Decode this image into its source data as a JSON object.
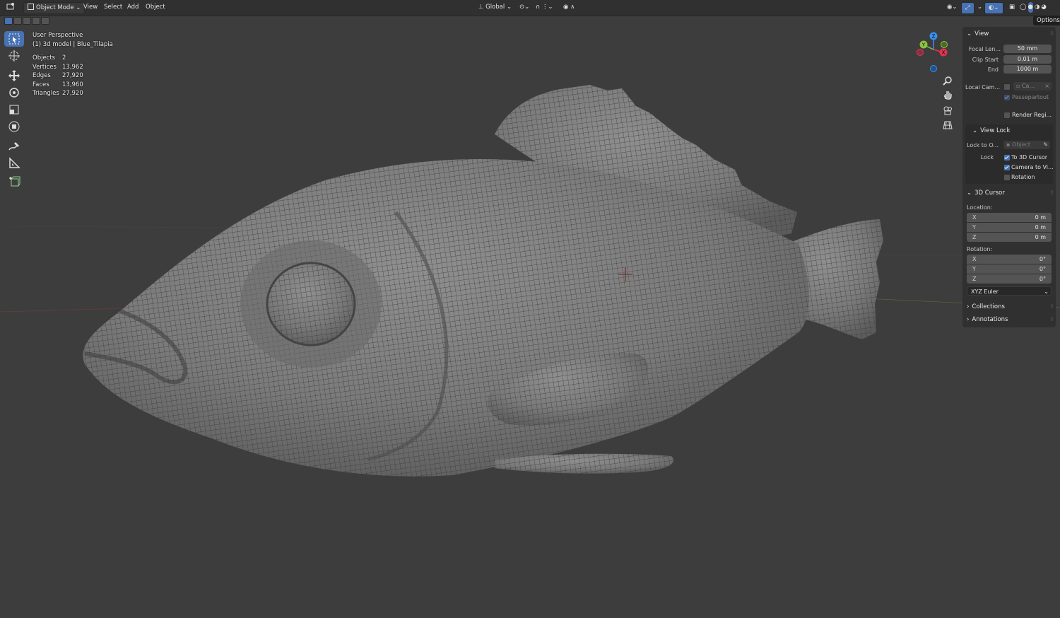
{
  "header": {
    "mode_label": "Object Mode",
    "menus": [
      "View",
      "Select",
      "Add",
      "Object"
    ],
    "orientation_label": "Global",
    "options_label": "Options"
  },
  "overlay": {
    "perspective": "User Perspective",
    "object_info": "(1) 3d model | Blue_Tilapia",
    "stats": [
      {
        "label": "Objects",
        "value": "2"
      },
      {
        "label": "Vertices",
        "value": "13,962"
      },
      {
        "label": "Edges",
        "value": "27,920"
      },
      {
        "label": "Faces",
        "value": "13,960"
      },
      {
        "label": "Triangles",
        "value": "27,920"
      }
    ]
  },
  "gizmo": {
    "x": "X",
    "y": "Y",
    "z": "Z",
    "x_color": "#e0364f",
    "y_color": "#8bc53f",
    "z_color": "#3b8ef0"
  },
  "npanel": {
    "view": {
      "title": "View",
      "focal_length_label": "Focal Len...",
      "focal_length_value": "50 mm",
      "clip_start_label": "Clip Start",
      "clip_start_value": "0.01 m",
      "clip_end_label": "End",
      "clip_end_value": "1000 m",
      "local_camera_label": "Local Cam...",
      "local_camera_value": "Ca...",
      "passepartout_label": "Passepartout",
      "render_region_label": "Render Regi..."
    },
    "view_lock": {
      "title": "View Lock",
      "lock_to_label": "Lock to O...",
      "lock_to_placeholder": "Object",
      "lock_label": "Lock",
      "to_3d_cursor": "To 3D Cursor",
      "camera_to_view": "Camera to Vi...",
      "rotation": "Rotation"
    },
    "cursor": {
      "title": "3D Cursor",
      "location_label": "Location:",
      "location": [
        {
          "axis": "X",
          "value": "0 m"
        },
        {
          "axis": "Y",
          "value": "0 m"
        },
        {
          "axis": "Z",
          "value": "0 m"
        }
      ],
      "rotation_label": "Rotation:",
      "rotation": [
        {
          "axis": "X",
          "value": "0°"
        },
        {
          "axis": "Y",
          "value": "0°"
        },
        {
          "axis": "Z",
          "value": "0°"
        }
      ],
      "rotation_mode": "XYZ Euler"
    },
    "collections_title": "Collections",
    "annotations_title": "Annotations"
  }
}
